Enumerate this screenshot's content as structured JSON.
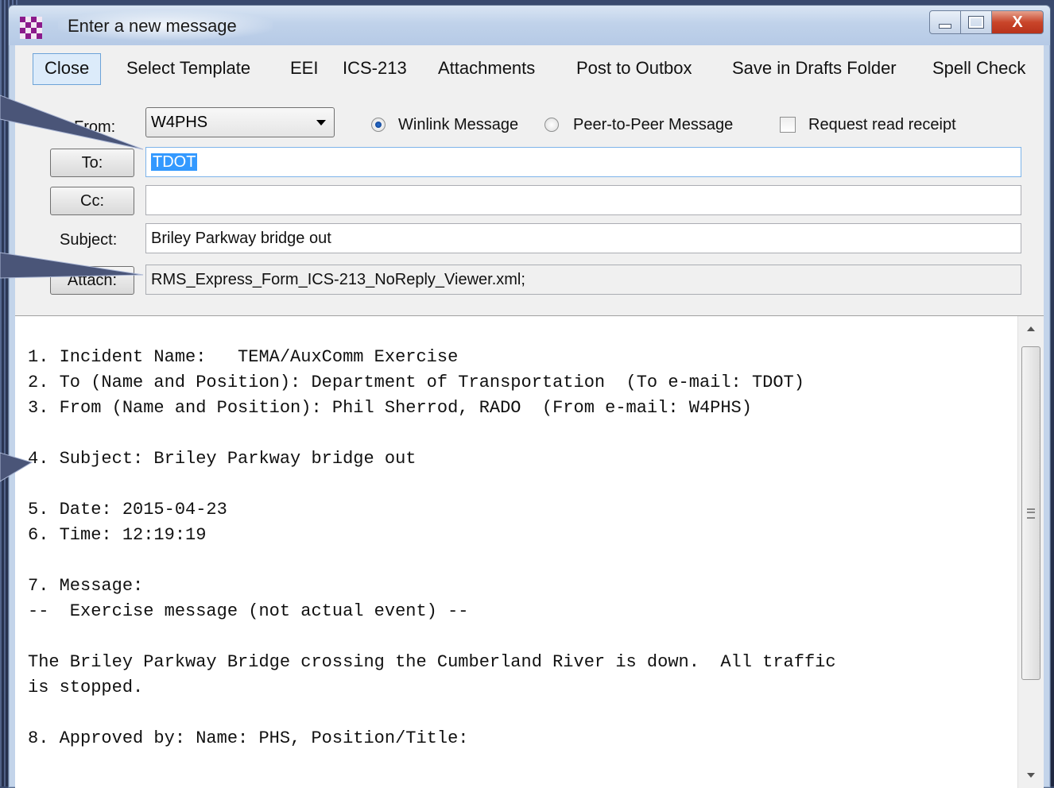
{
  "window": {
    "title": "Enter a new message",
    "close_glyph": "X"
  },
  "menu": [
    {
      "label": "Close",
      "active": true
    },
    {
      "label": "Select Template"
    },
    {
      "label": "EEI"
    },
    {
      "label": "ICS-213"
    },
    {
      "label": "Attachments"
    },
    {
      "label": "Post to Outbox"
    },
    {
      "label": "Save in Drafts Folder"
    },
    {
      "label": "Spell Check"
    }
  ],
  "form": {
    "from_label": "From:",
    "from_value": "W4PHS",
    "radio_winlink": "Winlink Message",
    "radio_winlink_selected": true,
    "radio_p2p": "Peer-to-Peer Message",
    "read_receipt_label": "Request read receipt",
    "read_receipt_checked": false,
    "to_button": "To:",
    "to_value": "TDOT",
    "cc_button": "Cc:",
    "cc_value": "",
    "subject_label": "Subject:",
    "subject_value": "Briley Parkway bridge out",
    "attach_button": "Attach:",
    "attach_value": "RMS_Express_Form_ICS-213_NoReply_Viewer.xml;"
  },
  "body_lines": [
    "1. Incident Name:   TEMA/AuxComm Exercise",
    "2. To (Name and Position): Department of Transportation  (To e-mail: TDOT)",
    "3. From (Name and Position): Phil Sherrod, RADO  (From e-mail: W4PHS)",
    "",
    "4. Subject: Briley Parkway bridge out",
    "",
    "5. Date: 2015-04-23",
    "6. Time: 12:19:19",
    "",
    "7. Message:",
    "--  Exercise message (not actual event) --",
    "",
    "The Briley Parkway Bridge crossing the Cumberland River is down.  All traffic",
    "is stopped.",
    "",
    "8. Approved by: Name: PHS, Position/Title:"
  ],
  "colors": {
    "selection": "#3399ff",
    "menu_active_bg": "#dcebfa",
    "close_button": "#c9452a"
  }
}
